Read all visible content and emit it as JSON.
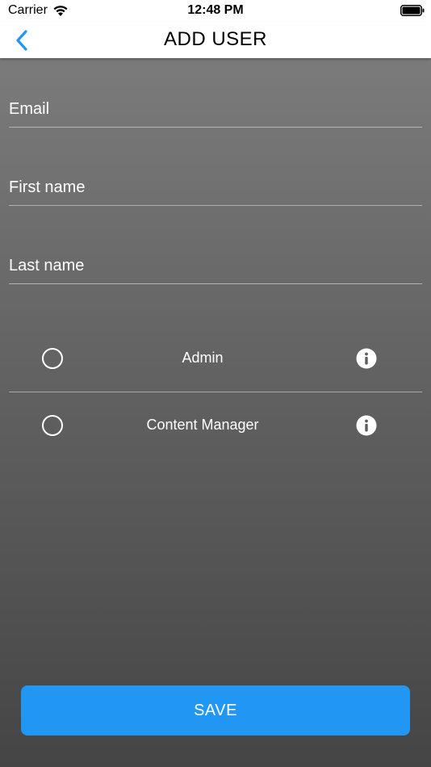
{
  "status_bar": {
    "carrier": "Carrier",
    "time": "12:48 PM"
  },
  "nav": {
    "title": "ADD USER",
    "back_icon": "chevron-left-icon"
  },
  "form": {
    "email_placeholder": "Email",
    "first_name_placeholder": "First name",
    "last_name_placeholder": "Last name"
  },
  "roles": [
    {
      "label": "Admin",
      "selected": false,
      "info_icon": "info-icon"
    },
    {
      "label": "Content Manager",
      "selected": false,
      "info_icon": "info-icon"
    }
  ],
  "save_label": "SAVE",
  "colors": {
    "accent": "#2196f3",
    "back_chevron": "#2196f3",
    "background_top": "#7b7b7b",
    "background_bottom": "#454545"
  }
}
